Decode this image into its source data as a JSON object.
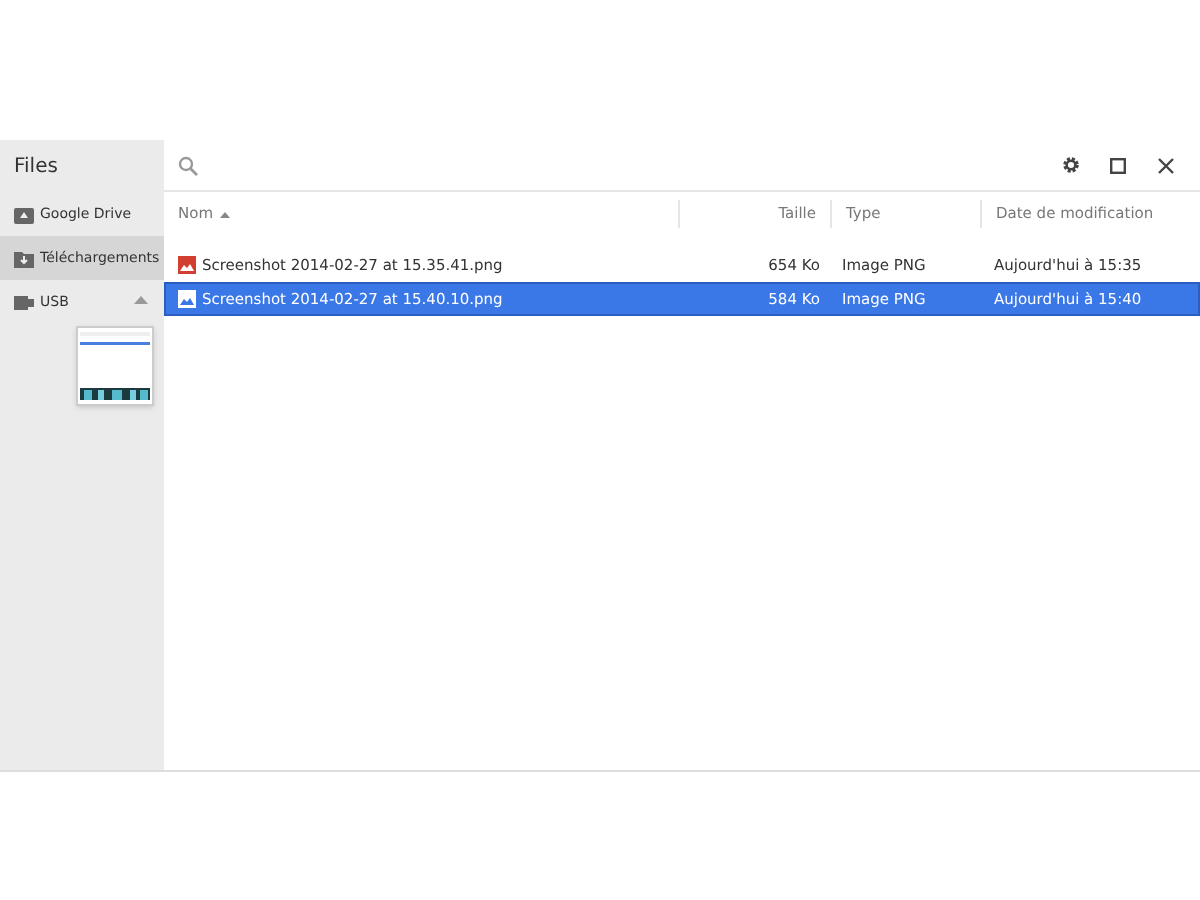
{
  "sidebar": {
    "title": "Files",
    "items": [
      {
        "label": "Google Drive",
        "kind": "drive",
        "selected": false,
        "ejectable": false
      },
      {
        "label": "Téléchargements",
        "kind": "folder",
        "selected": true,
        "ejectable": false
      },
      {
        "label": "USB",
        "kind": "usb",
        "selected": false,
        "ejectable": true
      }
    ]
  },
  "table": {
    "columns": [
      {
        "label": "Nom",
        "sorted": true
      },
      {
        "label": "Taille",
        "sorted": false
      },
      {
        "label": "Type",
        "sorted": false
      },
      {
        "label": "Date de modification",
        "sorted": false
      }
    ],
    "rows": [
      {
        "name": "Screenshot 2014-02-27 at 15.35.41.png",
        "size": "654 Ko",
        "type": "Image PNG",
        "date": "Aujourd'hui à 15:35",
        "selected": false
      },
      {
        "name": "Screenshot 2014-02-27 at 15.40.10.png",
        "size": "584 Ko",
        "type": "Image PNG",
        "date": "Aujourd'hui à 15:40",
        "selected": true
      }
    ]
  }
}
